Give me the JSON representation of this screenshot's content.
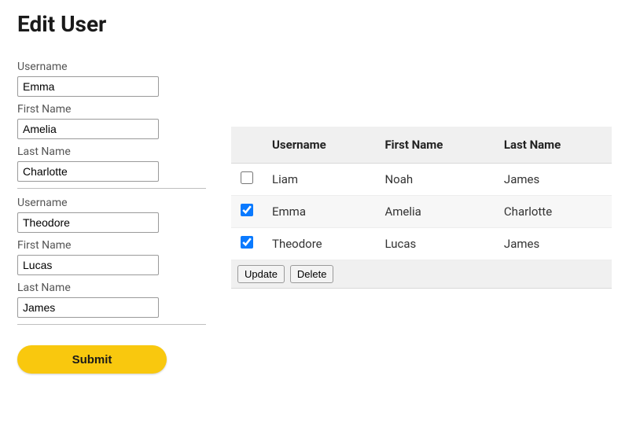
{
  "page": {
    "title": "Edit User"
  },
  "form": {
    "groups": [
      {
        "username": {
          "label": "Username",
          "value": "Emma"
        },
        "first_name": {
          "label": "First Name",
          "value": "Amelia"
        },
        "last_name": {
          "label": "Last Name",
          "value": "Charlotte"
        }
      },
      {
        "username": {
          "label": "Username",
          "value": "Theodore"
        },
        "first_name": {
          "label": "First Name",
          "value": "Lucas"
        },
        "last_name": {
          "label": "Last Name",
          "value": "James"
        }
      }
    ],
    "submit_label": "Submit"
  },
  "table": {
    "headers": {
      "username": "Username",
      "first_name": "First Name",
      "last_name": "Last Name"
    },
    "rows": [
      {
        "checked": false,
        "username": "Liam",
        "first_name": "Noah",
        "last_name": "James"
      },
      {
        "checked": true,
        "username": "Emma",
        "first_name": "Amelia",
        "last_name": "Charlotte"
      },
      {
        "checked": true,
        "username": "Theodore",
        "first_name": "Lucas",
        "last_name": "James"
      }
    ],
    "actions": {
      "update": "Update",
      "delete": "Delete"
    }
  }
}
